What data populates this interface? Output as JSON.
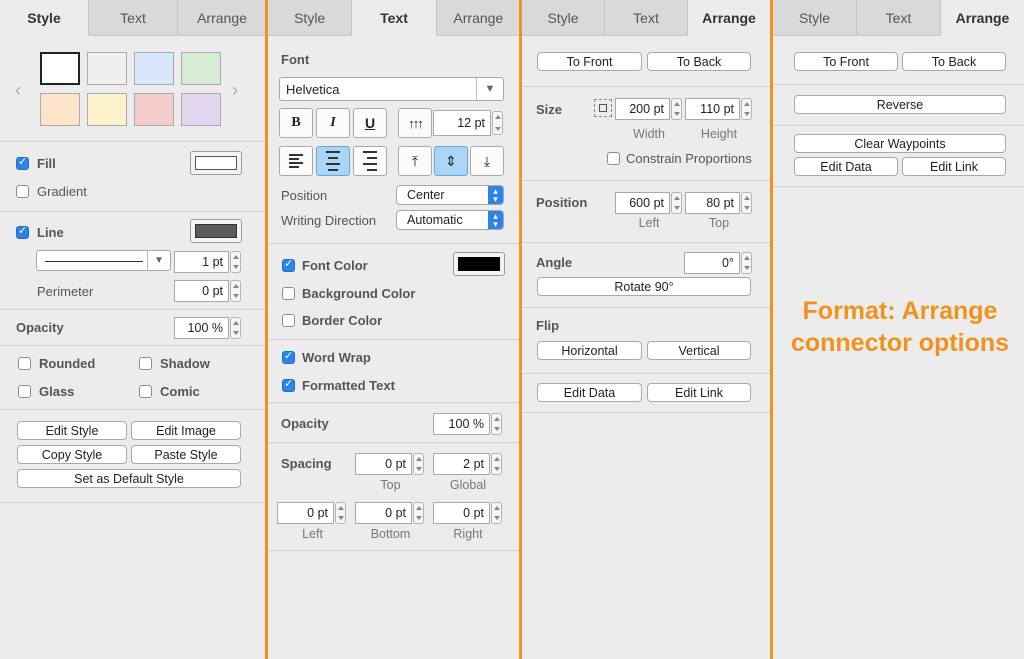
{
  "panel1": {
    "tabs": [
      "Style",
      "Text",
      "Arrange"
    ],
    "active_tab": "Style",
    "swatch_colors": [
      "#ffffff",
      "#efefef",
      "#d9e6fb",
      "#d7ecd6",
      "#fde3c8",
      "#fdf2cc",
      "#f5cccc",
      "#e2d6ee"
    ],
    "fill_label": "Fill",
    "fill_checked": true,
    "fill_color": "#ffffff",
    "gradient_label": "Gradient",
    "line_label": "Line",
    "line_checked": true,
    "line_color": "#5c5c5c",
    "line_width": "1 pt",
    "perimeter_label": "Perimeter",
    "perimeter_value": "0 pt",
    "opacity_label": "Opacity",
    "opacity_value": "100 %",
    "rounded_label": "Rounded",
    "shadow_label": "Shadow",
    "glass_label": "Glass",
    "comic_label": "Comic",
    "edit_style": "Edit Style",
    "edit_image": "Edit Image",
    "copy_style": "Copy Style",
    "paste_style": "Paste Style",
    "set_default": "Set as Default Style"
  },
  "panel2": {
    "tabs": [
      "Style",
      "Text",
      "Arrange"
    ],
    "active_tab": "Text",
    "font_label": "Font",
    "font_name": "Helvetica",
    "bold": "B",
    "italic": "I",
    "underline": "U",
    "font_size": "12 pt",
    "position_label": "Position",
    "position_value": "Center",
    "writing_direction_label": "Writing Direction",
    "writing_direction_value": "Automatic",
    "font_color_label": "Font Color",
    "font_color": "#000000",
    "background_color_label": "Background Color",
    "border_color_label": "Border Color",
    "word_wrap_label": "Word Wrap",
    "formatted_text_label": "Formatted Text",
    "opacity_label": "Opacity",
    "opacity_value": "100 %",
    "spacing_label": "Spacing",
    "spacing_top": "0 pt",
    "spacing_top_label": "Top",
    "spacing_global": "2 pt",
    "spacing_global_label": "Global",
    "spacing_left": "0 pt",
    "spacing_left_label": "Left",
    "spacing_bottom": "0 pt",
    "spacing_bottom_label": "Bottom",
    "spacing_right": "0 pt",
    "spacing_right_label": "Right"
  },
  "panel3": {
    "tabs": [
      "Style",
      "Text",
      "Arrange"
    ],
    "active_tab": "Arrange",
    "to_front": "To Front",
    "to_back": "To Back",
    "size_label": "Size",
    "width_value": "200 pt",
    "width_label": "Width",
    "height_value": "110 pt",
    "height_label": "Height",
    "constrain_label": "Constrain Proportions",
    "position_label": "Position",
    "left_value": "600 pt",
    "left_label": "Left",
    "top_value": "80 pt",
    "top_label": "Top",
    "angle_label": "Angle",
    "angle_value": "0°",
    "rotate": "Rotate 90°",
    "flip_label": "Flip",
    "horizontal": "Horizontal",
    "vertical": "Vertical",
    "edit_data": "Edit Data",
    "edit_link": "Edit Link"
  },
  "panel4": {
    "tabs": [
      "Style",
      "Text",
      "Arrange"
    ],
    "active_tab": "Arrange",
    "to_front": "To Front",
    "to_back": "To Back",
    "reverse": "Reverse",
    "clear_waypoints": "Clear Waypoints",
    "edit_data": "Edit Data",
    "edit_link": "Edit Link"
  },
  "caption": {
    "line1": "Format: Arrange",
    "line2": "connector options"
  },
  "colors": {
    "accent": "#f0921e",
    "blue": "#2d84e8"
  }
}
